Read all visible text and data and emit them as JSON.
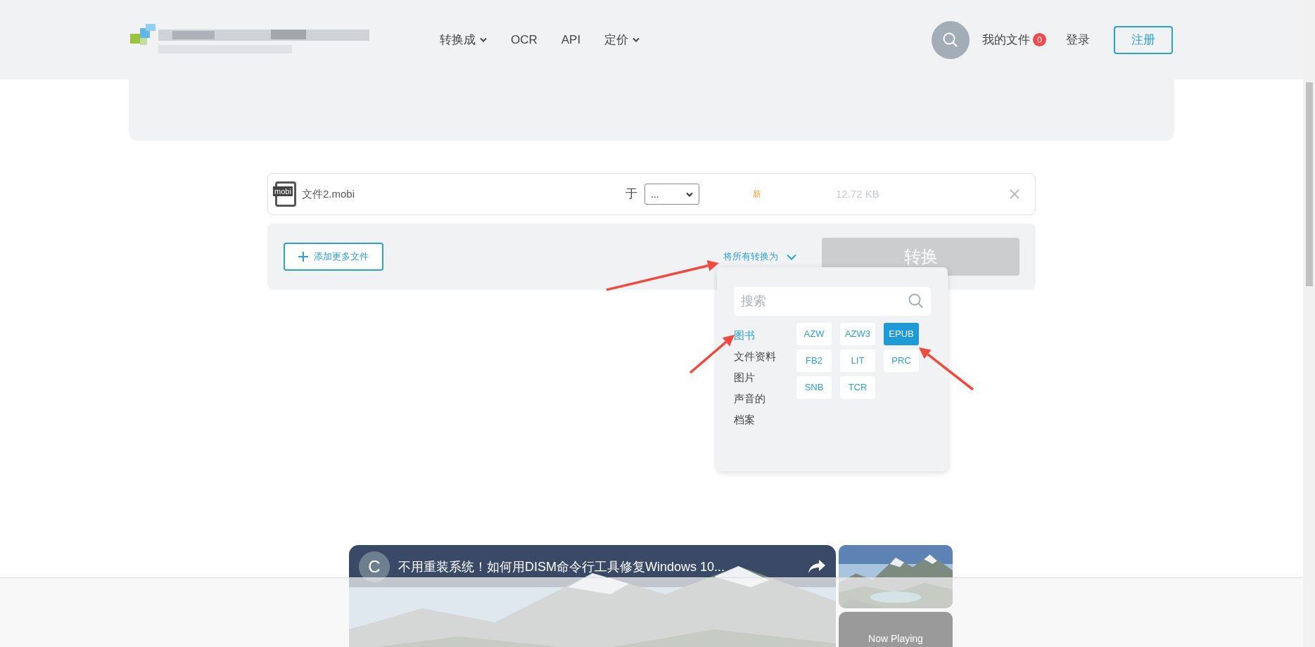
{
  "header": {
    "nav": [
      {
        "label": "转换成",
        "dropdown": true
      },
      {
        "label": "OCR",
        "dropdown": false
      },
      {
        "label": "API",
        "dropdown": false
      },
      {
        "label": "定价",
        "dropdown": true
      }
    ],
    "my_files": "我的文件",
    "file_count": "0",
    "login": "登录",
    "register": "注册"
  },
  "file": {
    "icon_label": "mobi",
    "name": "文件2.mobi",
    "to_label": "于",
    "target": "...",
    "status": "新",
    "size": "12.72 KB"
  },
  "actions": {
    "add_files": "添加更多文件",
    "convert_all": "将所有转换为",
    "convert": "转换",
    "convert_disabled": true
  },
  "format_menu": {
    "search_placeholder": "搜索",
    "categories": [
      {
        "label": "图书",
        "selected": true
      },
      {
        "label": "文件资料",
        "selected": false
      },
      {
        "label": "图片",
        "selected": false
      },
      {
        "label": "声音的",
        "selected": false
      },
      {
        "label": "档案",
        "selected": false
      }
    ],
    "formats": [
      {
        "label": "AZW",
        "selected": false
      },
      {
        "label": "AZW3",
        "selected": false
      },
      {
        "label": "EPUB",
        "selected": true
      },
      {
        "label": "FB2",
        "selected": false
      },
      {
        "label": "LIT",
        "selected": false
      },
      {
        "label": "PRC",
        "selected": false
      },
      {
        "label": "SNB",
        "selected": false
      },
      {
        "label": "TCR",
        "selected": false
      }
    ]
  },
  "video": {
    "channel_initial": "C",
    "title": "不用重装系统！如何用DISM命令行工具修复Windows 10...",
    "next_label": "Now Playing"
  }
}
